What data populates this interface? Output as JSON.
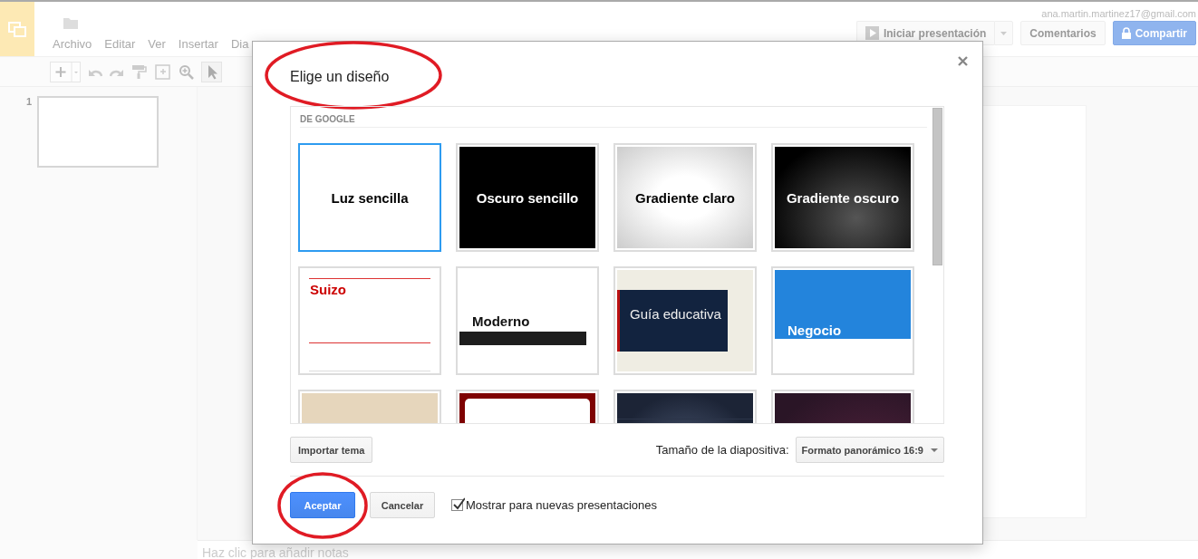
{
  "app": {
    "account": "ana.martin.martinez17@gmail.com",
    "menu": [
      "Archivo",
      "Editar",
      "Ver",
      "Insertar",
      "Dia"
    ],
    "header_buttons": [
      {
        "label": "Iniciar presentación",
        "kind": "present"
      },
      {
        "label": "Comentarios",
        "kind": "plain"
      },
      {
        "label": "Compartir",
        "kind": "share"
      }
    ],
    "filmstrip": [
      {
        "number": "1",
        "selected": false
      }
    ],
    "notes_placeholder": "Haz clic para añadir notas"
  },
  "dialog": {
    "title": {
      "text": "Elige un diseño",
      "circled": true
    },
    "section": "DE GOOGLE",
    "themes": [
      {
        "label": "Luz sencilla",
        "kind": "plain",
        "selected": true
      },
      {
        "label": "Oscuro sencillo",
        "kind": "dark",
        "selected": false
      },
      {
        "label": "Gradiente claro",
        "kind": "glow",
        "selected": false
      },
      {
        "label": "Gradiente oscuro",
        "kind": "shade",
        "selected": false
      },
      {
        "label": "Suizo",
        "kind": "lines",
        "selected": false
      },
      {
        "label": "Moderno",
        "kind": "bar",
        "selected": false
      },
      {
        "label": "Guía educativa",
        "kind": "panel",
        "selected": false
      },
      {
        "label": "Negocio",
        "kind": "banner",
        "selected": false
      },
      {
        "kind": "sand",
        "selected": false
      },
      {
        "kind": "frame",
        "selected": false
      },
      {
        "kind": "stage",
        "selected": false
      },
      {
        "kind": "vignette",
        "selected": false
      }
    ],
    "import_button": "Importar tema",
    "size_label": "Tamaño de la diapositiva:",
    "size_value": "Formato panorámico 16:9",
    "buttons": [
      {
        "label": "Aceptar",
        "kind": "primary",
        "circled": true
      },
      {
        "label": "Cancelar",
        "kind": "secondary",
        "circled": false
      }
    ],
    "checkbox": {
      "label": "Mostrar para nuevas presentaciones",
      "checked": true
    }
  }
}
